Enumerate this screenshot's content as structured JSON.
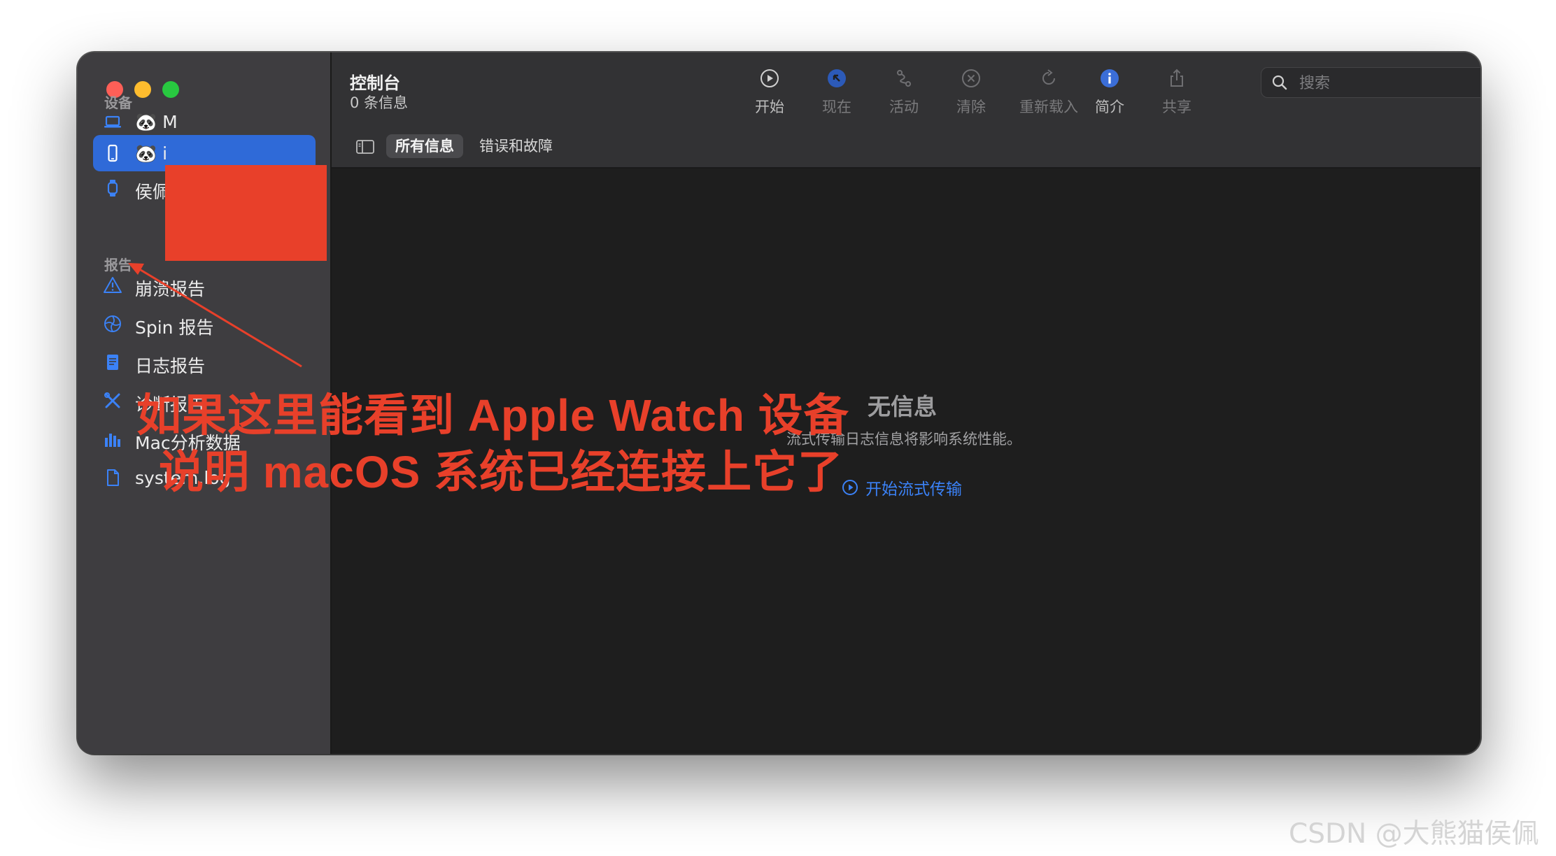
{
  "sidebar": {
    "devices_title": "设备",
    "devices": [
      {
        "icon": "laptop-icon",
        "label": "🐼 M",
        "selected": false
      },
      {
        "icon": "iphone-icon",
        "label": "🐼 i",
        "selected": true
      },
      {
        "icon": "watch-icon",
        "label": "侯佩",
        "selected": false
      }
    ],
    "reports_title": "报告",
    "reports": [
      {
        "icon": "warning-icon",
        "label": "崩溃报告"
      },
      {
        "icon": "spin-icon",
        "label": "Spin 报告"
      },
      {
        "icon": "document-icon",
        "label": "日志报告"
      },
      {
        "icon": "tools-icon",
        "label": "诊断报告"
      },
      {
        "icon": "bar-chart-icon",
        "label": "Mac分析数据"
      },
      {
        "icon": "file-icon",
        "label": "system.log"
      }
    ]
  },
  "header": {
    "title": "控制台",
    "subtitle": "0 条信息"
  },
  "toolbar": {
    "start": "开始",
    "now": "现在",
    "activity": "活动",
    "clear": "清除",
    "reload": "重新载入",
    "info": "简介",
    "share": "共享"
  },
  "search": {
    "placeholder": "搜索",
    "value": ""
  },
  "filters": {
    "all": "所有信息",
    "errors": "错误和故障"
  },
  "empty_state": {
    "title": "无信息",
    "description": "流式传输日志信息将影响系统性能。",
    "action": "开始流式传输"
  },
  "annotation": {
    "line1": "如果这里能看到 Apple Watch  设备",
    "line2": "说明 macOS 系统已经连接上它了"
  },
  "watermark": "CSDN @大熊猫侯佩",
  "colors": {
    "accent": "#2f6ad8",
    "link": "#3b82f7",
    "annotation": "#e8402a",
    "sidebar": "#3e3d40",
    "content": "#1e1e1e"
  }
}
